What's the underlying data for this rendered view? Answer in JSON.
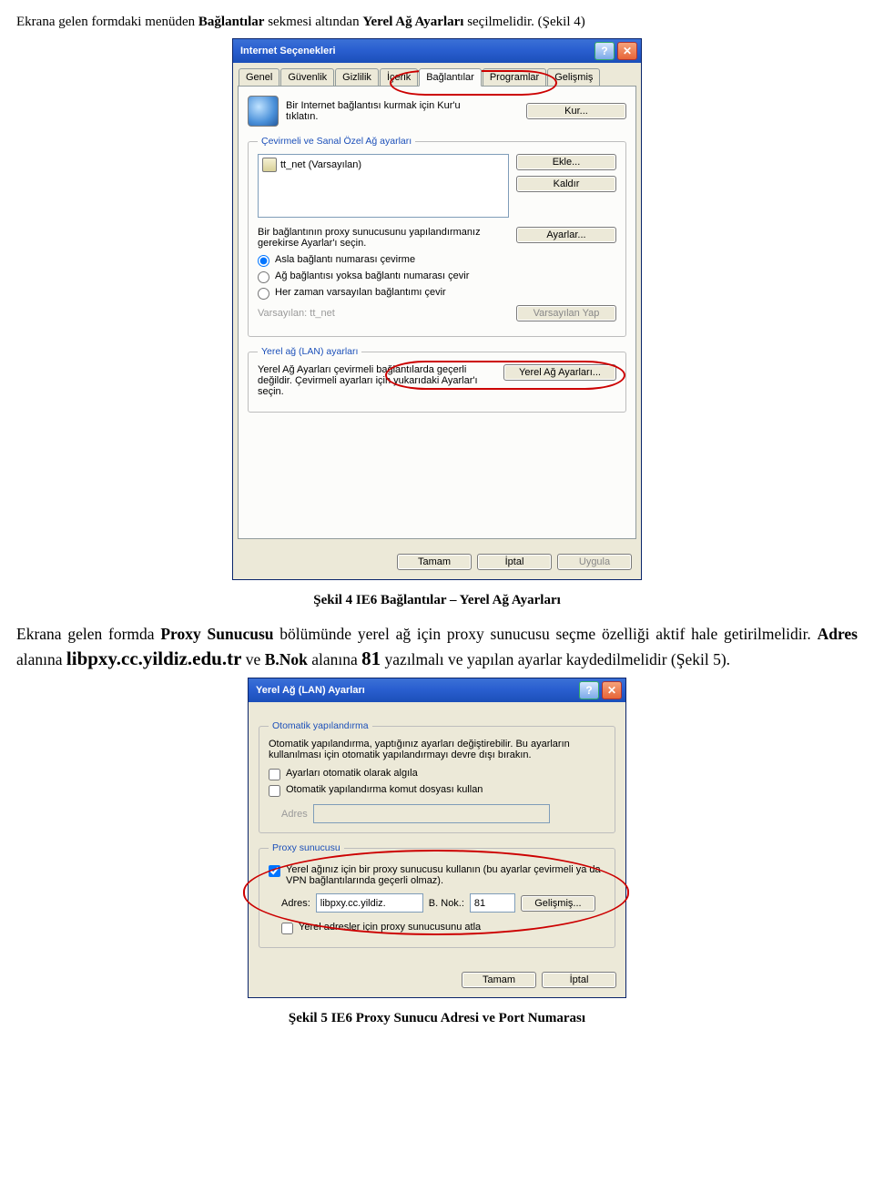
{
  "intro": {
    "pre": "Ekrana gelen formdaki menüden ",
    "bold1": "Bağlantılar",
    "mid1": " sekmesi altından ",
    "bold2": "Yerel Ağ Ayarları",
    "post": " seçilmelidir. (Şekil 4)"
  },
  "dlg1": {
    "title": "Internet Seçenekleri",
    "tabs": [
      "Genel",
      "Güvenlik",
      "Gizlilik",
      "İçerik",
      "Bağlantılar",
      "Programlar",
      "Gelişmiş"
    ],
    "setup_text": "Bir Internet bağlantısı kurmak için Kur'u tıklatın.",
    "btn_setup": "Kur...",
    "group_dial": "Çevirmeli ve Sanal Özel Ağ ayarları",
    "list_item": "tt_net (Varsayılan)",
    "btn_add": "Ekle...",
    "btn_remove": "Kaldır",
    "proxy_note": "Bir bağlantının proxy sunucusunu yapılandırmanız gerekirse Ayarlar'ı seçin.",
    "btn_settings": "Ayarlar...",
    "radio1": "Asla bağlantı numarası çevirme",
    "radio2": "Ağ bağlantısı yoksa bağlantı numarası çevir",
    "radio3": "Her zaman varsayılan bağlantımı çevir",
    "default_label_pre": "Varsayılan: ",
    "default_value": "tt_net",
    "btn_set_default": "Varsayılan Yap",
    "group_lan": "Yerel ağ (LAN) ayarları",
    "lan_note": "Yerel Ağ Ayarları çevirmeli bağlantılarda geçerli değildir. Çevirmeli ayarları için yukarıdaki Ayarlar'ı seçin.",
    "btn_lan": "Yerel Ağ Ayarları...",
    "btn_ok": "Tamam",
    "btn_cancel": "İptal",
    "btn_apply": "Uygula"
  },
  "caption1": "Şekil 4 IE6 Bağlantılar – Yerel Ağ Ayarları",
  "para2": {
    "pre": "Ekrana gelen formda ",
    "bold1": "Proxy Sunucusu",
    "mid1": " bölümünde yerel ağ için proxy sunucusu seçme özelliği aktif hale getirilmelidir. ",
    "bold2": "Adres",
    "mid2": " alanına   ",
    "addr": "libpxy.cc.yildiz.edu.tr",
    "mid3": "  ve  ",
    "bold3": "B.Nok",
    "mid4": " alanına      ",
    "port": "81",
    "post": "    yazılmalı ve yapılan ayarlar kaydedilmelidir (Şekil 5)."
  },
  "dlg2": {
    "title": "Yerel Ağ (LAN) Ayarları",
    "group_auto": "Otomatik yapılandırma",
    "auto_note": "Otomatik yapılandırma, yaptığınız ayarları değiştirebilir. Bu ayarların kullanılması için otomatik yapılandırmayı devre dışı bırakın.",
    "chk_auto_detect": "Ayarları otomatik olarak algıla",
    "chk_auto_script": "Otomatik yapılandırma komut dosyası kullan",
    "label_address": "Adres",
    "group_proxy": "Proxy sunucusu",
    "chk_proxy": "Yerel ağınız için bir proxy sunucusu kullanın (bu ayarlar çevirmeli ya da VPN bağlantılarında geçerli olmaz).",
    "label_addr2": "Adres:",
    "input_addr": "libpxy.cc.yildiz.",
    "label_port": "B. Nok.:",
    "input_port": "81",
    "btn_advanced": "Gelişmiş...",
    "chk_bypass": "Yerel adresler için proxy sunucusunu atla",
    "btn_ok": "Tamam",
    "btn_cancel": "İptal"
  },
  "caption2": "Şekil 5 IE6 Proxy Sunucu Adresi ve Port Numarası"
}
